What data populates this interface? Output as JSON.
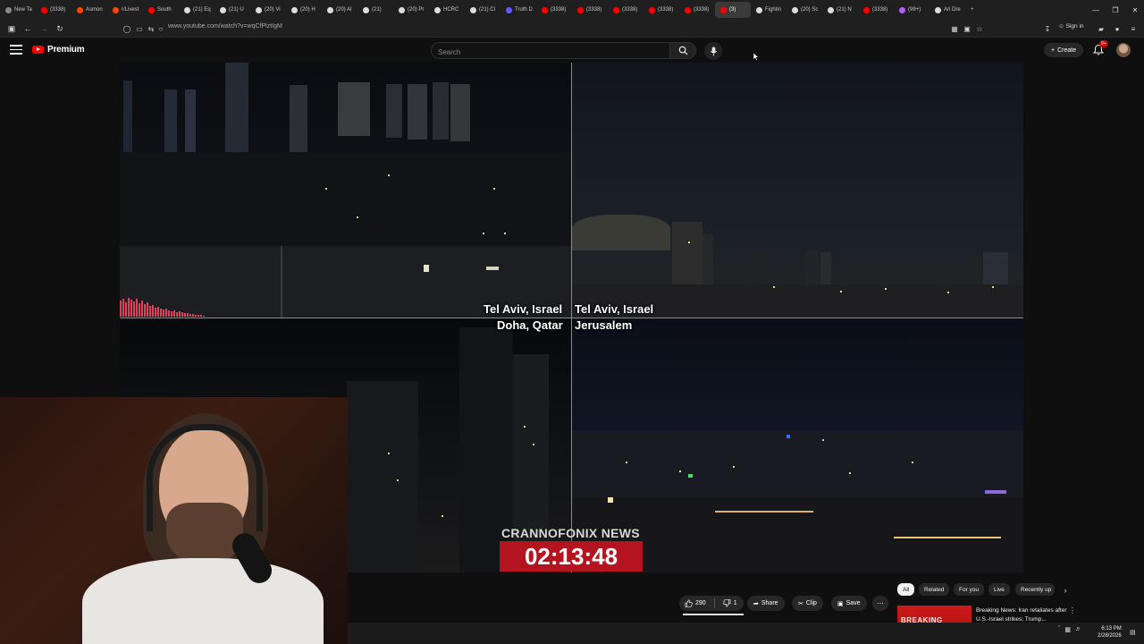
{
  "browser": {
    "tabs": [
      {
        "label": "New Ta",
        "color": "#888888"
      },
      {
        "label": "(3338)",
        "color": "#ff0000"
      },
      {
        "label": "Asmon",
        "color": "#ff4500"
      },
      {
        "label": "r/Livest",
        "color": "#ff4500"
      },
      {
        "label": "South",
        "color": "#ff0000"
      },
      {
        "label": "(21) Eq",
        "color": "#dddddd"
      },
      {
        "label": "(21) U",
        "color": "#dddddd"
      },
      {
        "label": "(20) Vi",
        "color": "#dddddd"
      },
      {
        "label": "(20) H",
        "color": "#dddddd"
      },
      {
        "label": "(20) Al",
        "color": "#dddddd"
      },
      {
        "label": "(21)",
        "color": "#dddddd"
      },
      {
        "label": "(20) Pr",
        "color": "#dddddd"
      },
      {
        "label": "HCRC",
        "color": "#dddddd"
      },
      {
        "label": "(21) Cl",
        "color": "#dddddd"
      },
      {
        "label": "Truth D",
        "color": "#5b5bff"
      },
      {
        "label": "(3338)",
        "color": "#ff0000"
      },
      {
        "label": "(3338)",
        "color": "#ff0000"
      },
      {
        "label": "(3338)",
        "color": "#ff0000"
      },
      {
        "label": "(3338)",
        "color": "#ff0000"
      },
      {
        "label": "(3338)",
        "color": "#ff0000"
      },
      {
        "label": "(3)",
        "color": "#ff0000",
        "active": true
      },
      {
        "label": "Fightin",
        "color": "#dddddd"
      },
      {
        "label": "(20) Sc",
        "color": "#dddddd"
      },
      {
        "label": "(21) N",
        "color": "#dddddd"
      },
      {
        "label": "(3338)",
        "color": "#ff0000"
      },
      {
        "label": "(99+)",
        "color": "#b65cff"
      },
      {
        "label": "Ari Dre",
        "color": "#dddddd"
      }
    ],
    "url": "www.youtube.com/watch?v=wqCfPlztIgM",
    "sign_in": "Sign in"
  },
  "masthead": {
    "logo_text": "Premium",
    "search_placeholder": "Search",
    "create_label": "Create",
    "notif_badge": "9+"
  },
  "video": {
    "labels": {
      "tl": "Tel Aviv, Israel",
      "tr": "Tel Aviv, Israel",
      "bl": "Doha, Qatar",
      "br": "Jerusalem"
    },
    "news_title": "CRANNOFONIX NEWS",
    "timer": "02:13:48"
  },
  "actions": {
    "likes": "290",
    "dislikes": "1",
    "share": "Share",
    "clip": "Clip",
    "save": "Save"
  },
  "chips": [
    "All",
    "Related",
    "For you",
    "Live",
    "Recently up"
  ],
  "recommendation": {
    "thumb_text": "BREAKING",
    "title": "Breaking News: Iran retaliates after U.S.-Israel strikes; Trump..."
  },
  "taskbar": {
    "time": "6:13 PM",
    "date": "2/28/2026"
  }
}
